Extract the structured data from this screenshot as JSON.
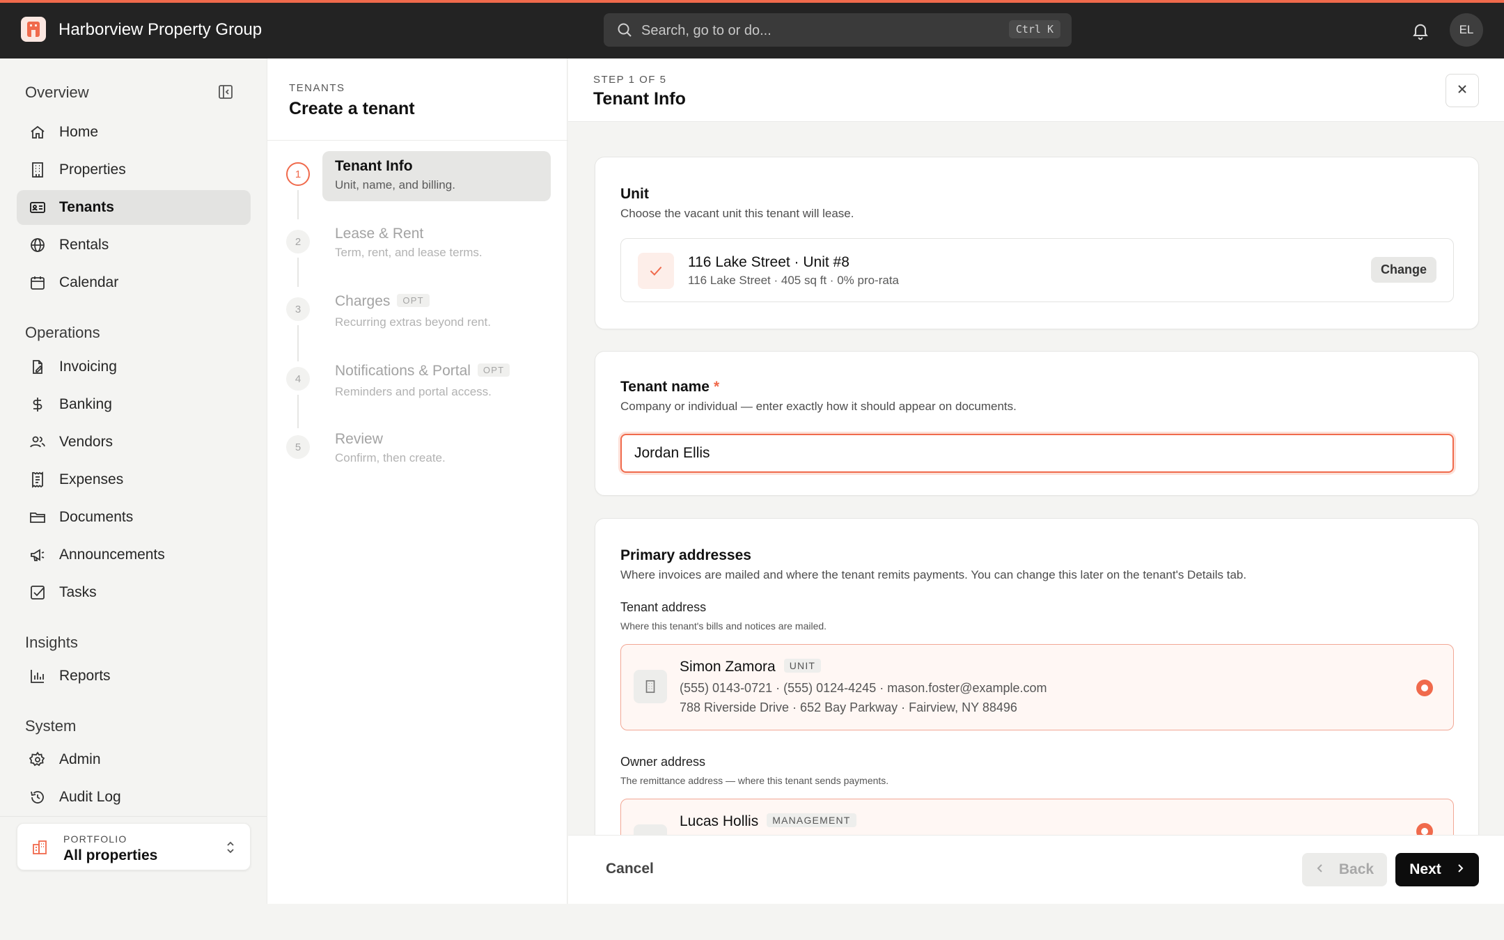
{
  "app": {
    "brand_name": "Harborview Property Group",
    "accent_color": "#f06a4c"
  },
  "search": {
    "placeholder": "Search, go to or do...",
    "shortcut": "Ctrl K"
  },
  "user": {
    "initials": "EL"
  },
  "sidebar": {
    "sections": [
      {
        "title": "Overview"
      },
      {
        "title": "Operations"
      },
      {
        "title": "Insights"
      },
      {
        "title": "System"
      }
    ],
    "items": [
      {
        "label": "Home",
        "icon": "home-icon"
      },
      {
        "label": "Properties",
        "icon": "building-icon"
      },
      {
        "label": "Tenants",
        "icon": "id-card-icon",
        "active": true
      },
      {
        "label": "Rentals",
        "icon": "globe-icon"
      },
      {
        "label": "Calendar",
        "icon": "calendar-icon"
      },
      {
        "label": "Invoicing",
        "icon": "invoice-icon"
      },
      {
        "label": "Banking",
        "icon": "dollar-icon"
      },
      {
        "label": "Vendors",
        "icon": "users-icon"
      },
      {
        "label": "Expenses",
        "icon": "receipt-icon"
      },
      {
        "label": "Documents",
        "icon": "folder-icon"
      },
      {
        "label": "Announcements",
        "icon": "megaphone-icon"
      },
      {
        "label": "Tasks",
        "icon": "checkbox-icon"
      },
      {
        "label": "Reports",
        "icon": "bar-chart-icon"
      },
      {
        "label": "Admin",
        "icon": "gear-icon"
      },
      {
        "label": "Audit Log",
        "icon": "history-icon"
      }
    ],
    "portfolio": {
      "label": "PORTFOLIO",
      "value": "All properties"
    }
  },
  "wizard": {
    "eyebrow": "TENANTS",
    "title": "Create a tenant",
    "steps": [
      {
        "number": "1",
        "label": "Tenant Info",
        "desc": "Unit, name, and billing.",
        "optional": false
      },
      {
        "number": "2",
        "label": "Lease & Rent",
        "desc": "Term, rent, and lease terms.",
        "optional": false
      },
      {
        "number": "3",
        "label": "Charges",
        "desc": "Recurring extras beyond rent.",
        "optional": true
      },
      {
        "number": "4",
        "label": "Notifications & Portal",
        "desc": "Reminders and portal access.",
        "optional": true
      },
      {
        "number": "5",
        "label": "Review",
        "desc": "Confirm, then create.",
        "optional": false
      }
    ],
    "optional_tag": "OPT"
  },
  "main": {
    "step_eyebrow": "STEP 1 OF 5",
    "step_title": "Tenant Info",
    "unit_card": {
      "title": "Unit",
      "desc": "Choose the vacant unit this tenant will lease.",
      "selected_name": "116 Lake Street · Unit #8",
      "selected_meta": "116 Lake Street · 405 sq ft · 0% pro-rata",
      "change_label": "Change"
    },
    "name_card": {
      "title": "Tenant name",
      "required_mark": "*",
      "desc": "Company or individual — enter exactly how it should appear on documents.",
      "value": "Jordan Ellis"
    },
    "address_card": {
      "title": "Primary addresses",
      "desc": "Where invoices are mailed and where the tenant remits payments. You can change this later on the tenant's Details tab.",
      "tenant_title": "Tenant address",
      "tenant_desc": "Where this tenant's bills and notices are mailed.",
      "tenant_addr": {
        "name": "Simon Zamora",
        "badge": "UNIT",
        "contacts": "(555) 0143-0721 · (555) 0124-4245 · mason.foster@example.com",
        "address": "788 Riverside Drive · 652 Bay Parkway · Fairview, NY 88496"
      },
      "owner_title": "Owner address",
      "owner_desc": "The remittance address — where this tenant sends payments.",
      "owner_addr": {
        "name": "Lucas Hollis",
        "badge": "MANAGEMENT"
      }
    },
    "footer": {
      "cancel": "Cancel",
      "back": "Back",
      "next": "Next"
    }
  }
}
